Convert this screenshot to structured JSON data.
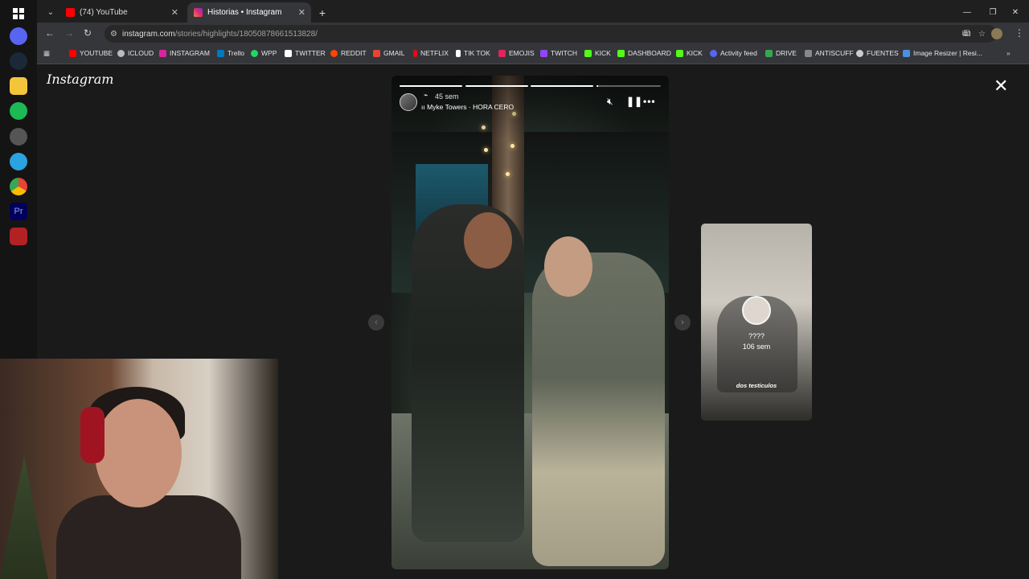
{
  "browser": {
    "tabs": [
      {
        "title": "(74) YouTube",
        "favicon_color": "#ff0000"
      },
      {
        "title": "Historias • Instagram",
        "favicon_color": "#d6249f"
      }
    ],
    "url_host": "instagram.com",
    "url_path": "/stories/highlights/18050878661513828/",
    "bookmarks": [
      {
        "label": "YOUTUBE",
        "color": "#ff0000"
      },
      {
        "label": "ICLOUD",
        "color": "#bbbbbb"
      },
      {
        "label": "INSTAGRAM",
        "color": "#d6249f"
      },
      {
        "label": "Trello",
        "color": "#0079bf"
      },
      {
        "label": "WPP",
        "color": "#25d366"
      },
      {
        "label": "TWITTER",
        "color": "#ffffff"
      },
      {
        "label": "REDDIT",
        "color": "#ff4500"
      },
      {
        "label": "GMAIL",
        "color": "#ea4335"
      },
      {
        "label": "NETFLIX",
        "color": "#e50914"
      },
      {
        "label": "TIK TOK",
        "color": "#ffffff"
      },
      {
        "label": "EMOJIS",
        "color": "#e0245e"
      },
      {
        "label": "TWITCH",
        "color": "#9146ff"
      },
      {
        "label": "KICK",
        "color": "#53fc18"
      },
      {
        "label": "DASHBOARD",
        "color": "#53fc18"
      },
      {
        "label": "KICK",
        "color": "#53fc18"
      },
      {
        "label": "Activity feed",
        "color": "#5865f2"
      },
      {
        "label": "DRIVE",
        "color": "#34a853"
      },
      {
        "label": "ANTISCUFF",
        "color": "#888888"
      },
      {
        "label": "FUENTES",
        "color": "#cccccc"
      },
      {
        "label": "Image Resizer | Resi...",
        "color": "#4a90e2"
      }
    ]
  },
  "instagram": {
    "logo": "Instagram",
    "story": {
      "time": "45 sem",
      "music": "Myke Towers · HORA CERO",
      "segment_progress": [
        1,
        1,
        1,
        0.02
      ]
    },
    "next_story": {
      "name": "????",
      "time": "106 sem",
      "caption": "dos testiculos"
    }
  }
}
